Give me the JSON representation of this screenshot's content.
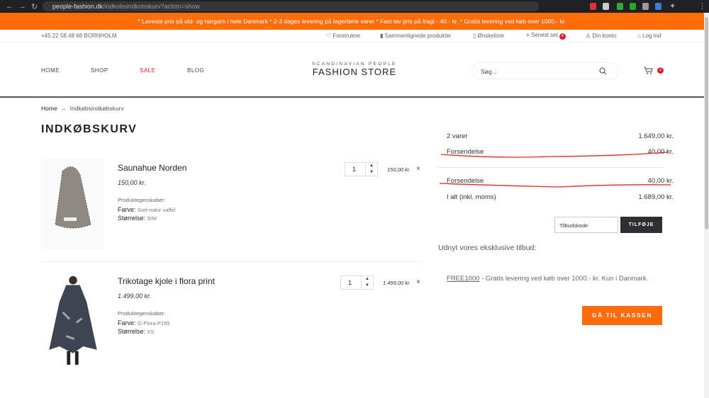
{
  "browser": {
    "url_host": "people-fashion.dk",
    "url_path": "/indkobsindkobskurv?action=show"
  },
  "promo": "* Laveste pris på uld- og hørgarn i hele Danmark * 2-3 dages levering på lagerførte varer * Fast lav pris på fragt - 40.- kr. * Gratis levering ved køb over 1000.- kr.",
  "topbar": {
    "phone": "+45 22 58 48 68 BORNHOLM",
    "links": [
      "Foretrukne",
      "Sammenlignede produkter",
      "Ønskeliste",
      "Senest set",
      "Din konto",
      "Log ind"
    ],
    "recent_count": "4"
  },
  "header": {
    "menu": [
      "HOME",
      "SHOP",
      "SALE",
      "BLOG"
    ],
    "logo_small": "SCANDINAVIAN PEOPLE",
    "logo_big": "FASHION STORE",
    "search_placeholder": "Søg...",
    "cart_count": "2"
  },
  "breadcrumb": {
    "home": "Home",
    "arrow": "→",
    "current": "Indkøbsindkøbskurv"
  },
  "title": "INDKØBSKURV",
  "items": [
    {
      "name": "Saunahue Norden",
      "price": "150,00 kr.",
      "props_label": "Produktegenskaber:",
      "color_label": "Farve:",
      "color": "Sort-natur vaffel",
      "size_label": "Størrelse:",
      "size": "S/M",
      "qty": "1",
      "total": "150,00 kr."
    },
    {
      "name": "Trikotage kjole i flora print",
      "price": "1.499,00 kr.",
      "props_label": "Produktegenskaber:",
      "color_label": "Farve:",
      "color": "G-Flora-P155",
      "size_label": "Størrelse:",
      "size": "XS",
      "qty": "1",
      "total": "1.499,00 kr."
    }
  ],
  "summary": {
    "items_label": "2 varer",
    "items_value": "1.649,00 kr.",
    "shipping_label": "Forsendelse",
    "shipping_value": "40,00 kr.",
    "shipping2_label": "Forsendelse",
    "shipping2_value": "40,00 kr.",
    "total_label": "I alt (inkl. moms)",
    "total_value": "1.689,00 kr."
  },
  "coupon": {
    "placeholder": "Tilbudskode",
    "button": "TILFØJE"
  },
  "offer": {
    "heading": "Udnyt vores eksklusive tilbud:",
    "code": "FREE1000",
    "text": " - Gratis levering ved køb over 1000.- kr. Kun i Danmark."
  },
  "checkout": "GÅ TIL KASSEN",
  "colors": {
    "accent": "#ff6c0a",
    "sale": "#e31b23",
    "dark": "#2d2f31"
  }
}
